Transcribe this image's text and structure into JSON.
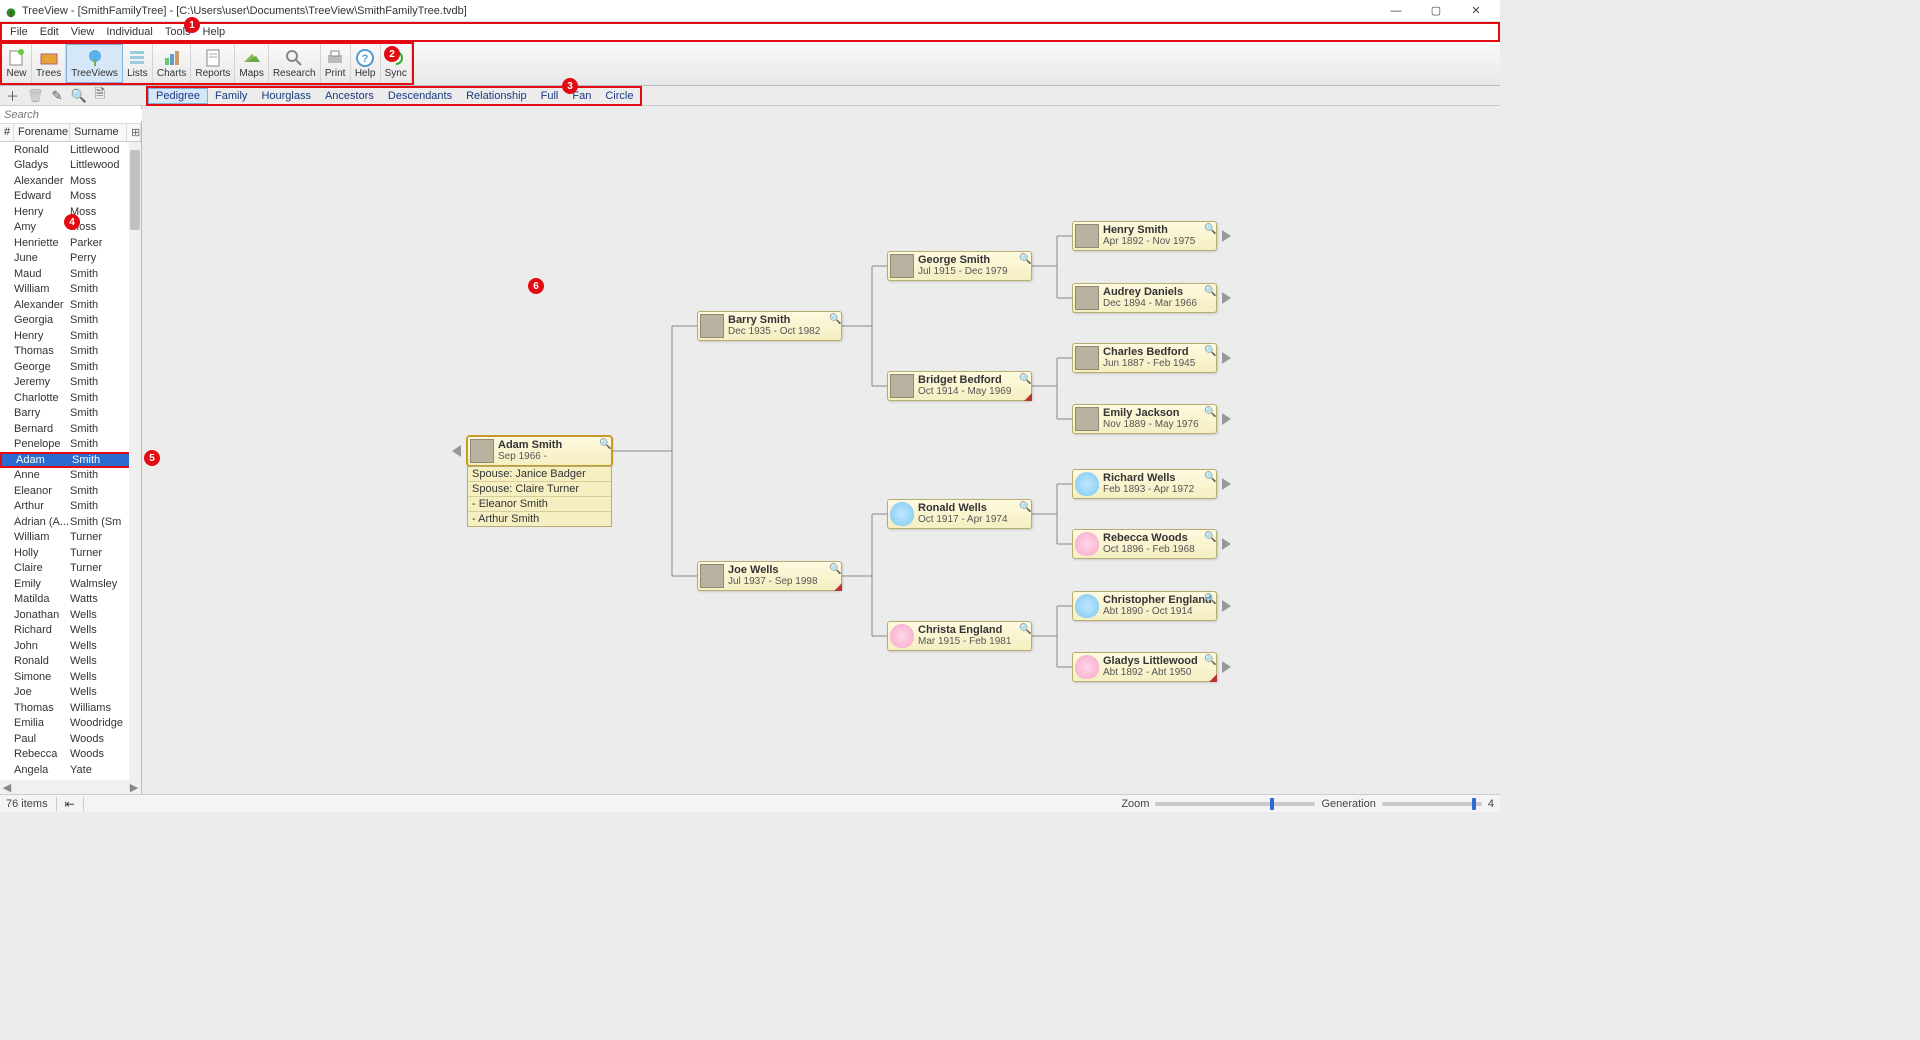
{
  "window": {
    "title": "TreeView - [SmithFamilyTree] - [C:\\Users\\user\\Documents\\TreeView\\SmithFamilyTree.tvdb]"
  },
  "menus": [
    "File",
    "Edit",
    "View",
    "Individual",
    "Tools",
    "Help"
  ],
  "annotations": {
    "1": "1",
    "2": "2",
    "3": "3",
    "4": "4",
    "5": "5",
    "6": "6"
  },
  "toolbar": [
    {
      "label": "New",
      "active": false
    },
    {
      "label": "Trees",
      "active": false
    },
    {
      "label": "TreeViews",
      "active": true
    },
    {
      "label": "Lists",
      "active": false
    },
    {
      "label": "Charts",
      "active": false
    },
    {
      "label": "Reports",
      "active": false
    },
    {
      "label": "Maps",
      "active": false
    },
    {
      "label": "Research",
      "active": false
    },
    {
      "label": "Print",
      "active": false
    },
    {
      "label": "Help",
      "active": false
    },
    {
      "label": "Sync",
      "active": false
    }
  ],
  "view_tabs": [
    "Pedigree",
    "Family",
    "Hourglass",
    "Ancestors",
    "Descendants",
    "Relationship",
    "Full",
    "Fan",
    "Circle"
  ],
  "active_view_tab": "Pedigree",
  "list_cols": {
    "idx": "#",
    "fore": "Forename",
    "sur": "Surname"
  },
  "search_placeholder": "Search",
  "people": [
    {
      "f": "Ronald",
      "s": "Littlewood"
    },
    {
      "f": "Gladys",
      "s": "Littlewood"
    },
    {
      "f": "Alexander",
      "s": "Moss"
    },
    {
      "f": "Edward",
      "s": "Moss"
    },
    {
      "f": "Henry",
      "s": "Moss"
    },
    {
      "f": "Amy",
      "s": "Moss"
    },
    {
      "f": "Henriette",
      "s": "Parker"
    },
    {
      "f": "June",
      "s": "Perry"
    },
    {
      "f": "Maud",
      "s": "Smith"
    },
    {
      "f": "William",
      "s": "Smith"
    },
    {
      "f": "Alexander",
      "s": "Smith"
    },
    {
      "f": "Georgia",
      "s": "Smith"
    },
    {
      "f": "Henry",
      "s": "Smith"
    },
    {
      "f": "Thomas",
      "s": "Smith"
    },
    {
      "f": "George",
      "s": "Smith"
    },
    {
      "f": "Jeremy",
      "s": "Smith"
    },
    {
      "f": "Charlotte",
      "s": "Smith"
    },
    {
      "f": "Barry",
      "s": "Smith"
    },
    {
      "f": "Bernard",
      "s": "Smith"
    },
    {
      "f": "Penelope",
      "s": "Smith"
    },
    {
      "f": "Adam",
      "s": "Smith",
      "selected": true
    },
    {
      "f": "Anne",
      "s": "Smith"
    },
    {
      "f": "Eleanor",
      "s": "Smith"
    },
    {
      "f": "Arthur",
      "s": "Smith"
    },
    {
      "f": "Adrian (A...",
      "s": "Smith (Sm"
    },
    {
      "f": "William",
      "s": "Turner"
    },
    {
      "f": "Holly",
      "s": "Turner"
    },
    {
      "f": "Claire",
      "s": "Turner"
    },
    {
      "f": "Emily",
      "s": "Walmsley"
    },
    {
      "f": "Matilda",
      "s": "Watts"
    },
    {
      "f": "Jonathan",
      "s": "Wells"
    },
    {
      "f": "Richard",
      "s": "Wells"
    },
    {
      "f": "John",
      "s": "Wells"
    },
    {
      "f": "Ronald",
      "s": "Wells"
    },
    {
      "f": "Simone",
      "s": "Wells"
    },
    {
      "f": "Joe",
      "s": "Wells"
    },
    {
      "f": "Thomas",
      "s": "Williams"
    },
    {
      "f": "Emilia",
      "s": "Woodridge"
    },
    {
      "f": "Paul",
      "s": "Woods"
    },
    {
      "f": "Rebecca",
      "s": "Woods"
    },
    {
      "f": "Angela",
      "s": "Yate"
    }
  ],
  "tree": {
    "root": {
      "name": "Adam Smith",
      "dates": "Sep 1966 -"
    },
    "root_details": [
      "Spouse: Janice Badger",
      "Spouse: Claire Turner",
      "  - Eleanor Smith",
      "  - Arthur Smith"
    ],
    "nodes": {
      "barry": {
        "name": "Barry Smith",
        "dates": "Dec 1935 - Oct 1982"
      },
      "joe": {
        "name": "Joe Wells",
        "dates": "Jul 1937 - Sep 1998"
      },
      "george": {
        "name": "George Smith",
        "dates": "Jul 1915 - Dec 1979"
      },
      "bridget": {
        "name": "Bridget Bedford",
        "dates": "Oct 1914 - May 1969"
      },
      "ronaldw": {
        "name": "Ronald Wells",
        "dates": "Oct 1917 - Apr 1974"
      },
      "christa": {
        "name": "Christa England",
        "dates": "Mar 1915 - Feb 1981"
      },
      "henry": {
        "name": "Henry Smith",
        "dates": "Apr 1892 - Nov 1975"
      },
      "audrey": {
        "name": "Audrey Daniels",
        "dates": "Dec 1894 - Mar 1966"
      },
      "charles": {
        "name": "Charles Bedford",
        "dates": "Jun 1887 - Feb 1945"
      },
      "emily": {
        "name": "Emily Jackson",
        "dates": "Nov 1889 - May 1976"
      },
      "richard": {
        "name": "Richard Wells",
        "dates": "Feb 1893 - Apr 1972"
      },
      "rebecca": {
        "name": "Rebecca Woods",
        "dates": "Oct 1896 - Feb 1968"
      },
      "chris": {
        "name": "Christopher England",
        "dates": "Abt 1890 - Oct 1914"
      },
      "gladys": {
        "name": "Gladys Littlewood",
        "dates": "Abt 1892 - Abt 1950"
      }
    }
  },
  "status": {
    "count": "76 items",
    "zoom": "Zoom",
    "gen": "Generation",
    "gen_val": "4"
  }
}
